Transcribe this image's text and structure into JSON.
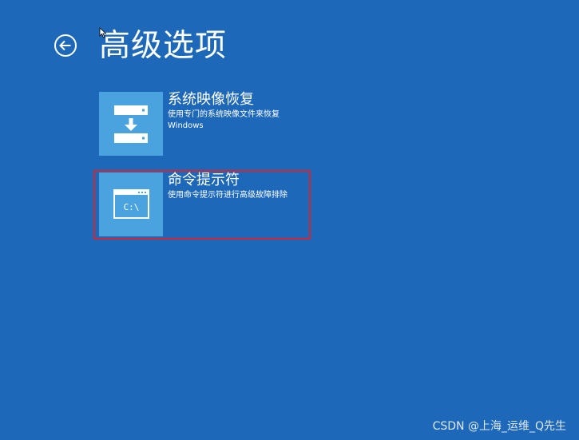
{
  "page": {
    "title": "高级选项",
    "background_color": "#1d68b8",
    "tile_icon_color": "#4aa3df",
    "highlight_color": "#d2252f"
  },
  "back": {
    "icon": "back-arrow-icon"
  },
  "options": [
    {
      "title": "系统映像恢复",
      "description_line1": "使用专门的系统映像文件来恢复",
      "description_line2": "Windows",
      "icon": "system-image-restore-icon"
    },
    {
      "title": "命令提示符",
      "description_line1": "使用命令提示符进行高级故障排除",
      "icon": "command-prompt-icon",
      "icon_text": "C:\\",
      "highlighted": true
    }
  ],
  "watermark": {
    "text": "CSDN @上海_运维_Q先生"
  }
}
